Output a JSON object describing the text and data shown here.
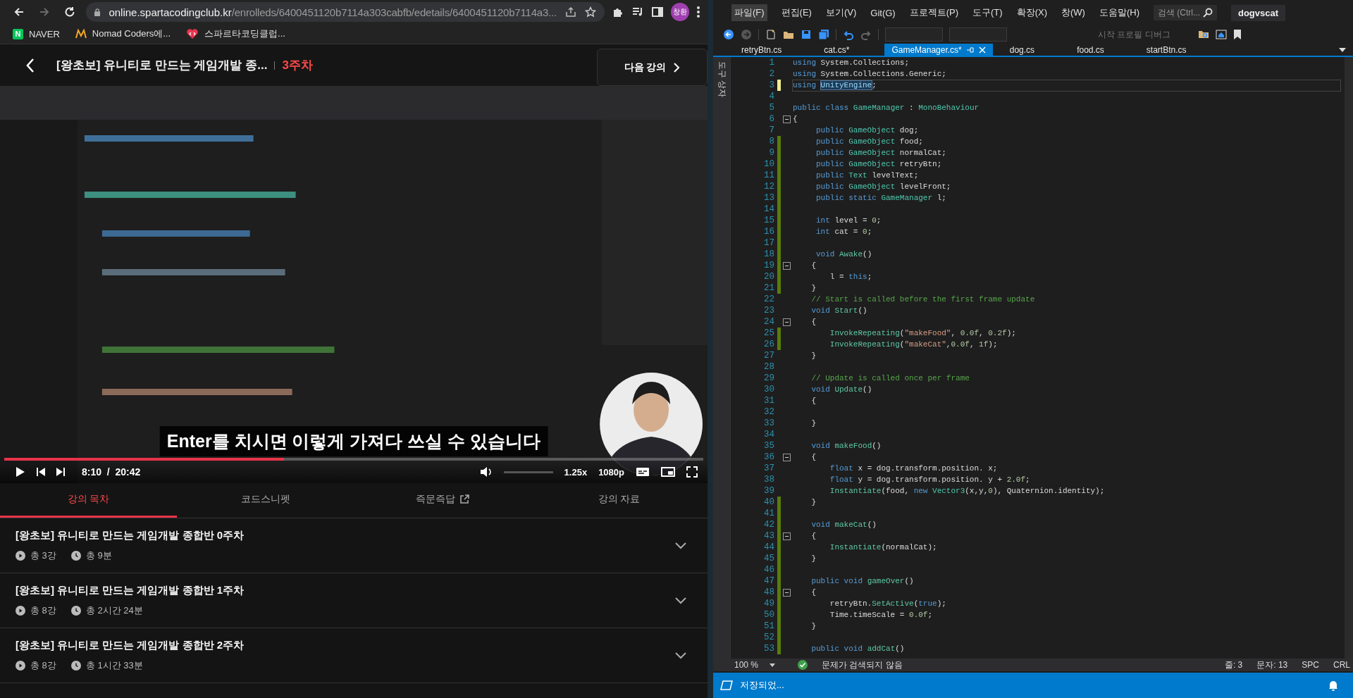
{
  "browser": {
    "nav": [
      {
        "kind": "back",
        "disabled": false
      },
      {
        "kind": "forward",
        "disabled": true
      },
      {
        "kind": "reload",
        "disabled": false
      }
    ],
    "address": {
      "host": "online.spartacodingclub.kr",
      "path": "/enrolleds/6400451120b7114a303cabfb/edetails/6400451120b7114a3..."
    },
    "profile": {
      "initials": "창환"
    },
    "bookmarks": [
      {
        "kind": "naver",
        "icon_text": "N",
        "label": "NAVER"
      },
      {
        "kind": "nomad",
        "label": "Nomad Coders에..."
      },
      {
        "kind": "sparta",
        "label": "스파르타코딩클럽..."
      }
    ]
  },
  "course_header": {
    "title": "[왕초보] 유니티로 만드는 게임개발 종...",
    "week": "3주차",
    "next_button": "다음 강의"
  },
  "video": {
    "kind": "picture",
    "subtitle": "Enter를 치시면 이렇게 가져다 쓰실 수 있습니다",
    "progress": {
      "level": 0.4
    },
    "time": "8:10  /  20:42",
    "volume": {
      "level": 0
    },
    "speed": "1.25x",
    "quality": "1080p"
  },
  "lecture_tabs": [
    {
      "label": "강의 목차",
      "selected": true,
      "external": false
    },
    {
      "label": "코드스니펫",
      "selected": false,
      "external": false
    },
    {
      "label": "즉문즉답",
      "selected": false,
      "external": true
    },
    {
      "label": "강의 자료",
      "selected": false,
      "external": false
    }
  ],
  "sections": [
    {
      "title": "[왕초보] 유니티로 만드는 게임개발 종합반 0주차",
      "lessons": "총 3강",
      "duration": "총 9분",
      "expanded": false
    },
    {
      "title": "[왕초보] 유니티로 만드는 게임개발 종합반 1주차",
      "lessons": "총 8강",
      "duration": "총 2시간 24분",
      "expanded": false
    },
    {
      "title": "[왕초보] 유니티로 만드는 게임개발 종합반 2주차",
      "lessons": "총 8강",
      "duration": "총 1시간 33분",
      "expanded": false
    }
  ],
  "ide": {
    "menu": [
      {
        "label": "파일(F)",
        "selected": true
      },
      {
        "label": "편집(E)",
        "selected": false
      },
      {
        "label": "보기(V)",
        "selected": false
      },
      {
        "label": "Git(G)",
        "selected": false
      },
      {
        "label": "프로젝트(P)",
        "selected": false
      },
      {
        "label": "도구(T)",
        "selected": false
      },
      {
        "label": "확장(X)",
        "selected": false
      },
      {
        "label": "창(W)",
        "selected": false
      },
      {
        "label": "도움말(H)",
        "selected": false
      }
    ],
    "search": {
      "placeholder": "검색 (Ctrl..."
    },
    "solution": "dogvscat",
    "debug_target": "시작 프로필 디버그",
    "side_tab": "도구 상자",
    "tabs": [
      {
        "label": "retryBtn.cs",
        "selected": false
      },
      {
        "label": "cat.cs*",
        "selected": false
      },
      {
        "label": "GameManager.cs*",
        "selected": true
      },
      {
        "label": "dog.cs",
        "selected": false
      },
      {
        "label": "food.cs",
        "selected": false
      },
      {
        "label": "startBtn.cs",
        "selected": false
      }
    ],
    "editor": {
      "lines": [
        {
          "n": "1",
          "fold": false,
          "current": false,
          "tokens": [
            {
              "kind": "kw",
              "text": "using"
            },
            {
              "kind": "txt",
              "text": " System.Collections;"
            }
          ]
        },
        {
          "n": "2",
          "fold": false,
          "current": false,
          "tokens": [
            {
              "kind": "kw",
              "text": "using"
            },
            {
              "kind": "txt",
              "text": " System.Collections.Generic;"
            }
          ]
        },
        {
          "n": "3",
          "color": "#efef91",
          "fold": false,
          "current": true,
          "tokens": [
            {
              "kind": "kw",
              "text": "using "
            },
            {
              "kind": "ref",
              "text": "UnityEngine"
            },
            {
              "kind": "txt",
              "text": ";"
            }
          ]
        },
        {
          "n": "4",
          "fold": false,
          "current": false
        },
        {
          "n": "5",
          "fold": false,
          "current": false,
          "tokens": [
            {
              "kind": "kw",
              "text": "public class "
            },
            {
              "kind": "type",
              "text": "GameManager"
            },
            {
              "kind": "txt",
              "text": " : "
            },
            {
              "kind": "type",
              "text": "MonoBehaviour"
            }
          ]
        },
        {
          "n": "6",
          "fold": true,
          "current": false,
          "tokens": [
            {
              "kind": "txt",
              "text": "{"
            }
          ]
        },
        {
          "n": "7",
          "fold": false,
          "current": false,
          "tokens": [
            {
              "kind": "kw",
              "text": "     public "
            },
            {
              "kind": "type",
              "text": "GameObject"
            },
            {
              "kind": "txt",
              "text": " dog;"
            }
          ]
        },
        {
          "n": "8",
          "color": "#587c0c",
          "fold": false,
          "current": false,
          "tokens": [
            {
              "kind": "kw",
              "text": "     public "
            },
            {
              "kind": "type",
              "text": "GameObject"
            },
            {
              "kind": "txt",
              "text": " food;"
            }
          ]
        },
        {
          "n": "9",
          "color": "#587c0c",
          "fold": false,
          "current": false,
          "tokens": [
            {
              "kind": "kw",
              "text": "     public "
            },
            {
              "kind": "type",
              "text": "GameObject"
            },
            {
              "kind": "txt",
              "text": " normalCat;"
            }
          ]
        },
        {
          "n": "10",
          "color": "#587c0c",
          "fold": false,
          "current": false,
          "tokens": [
            {
              "kind": "kw",
              "text": "     public "
            },
            {
              "kind": "type",
              "text": "GameObject"
            },
            {
              "kind": "txt",
              "text": " retryBtn;"
            }
          ]
        },
        {
          "n": "11",
          "color": "#587c0c",
          "fold": false,
          "current": false,
          "tokens": [
            {
              "kind": "kw",
              "text": "     public "
            },
            {
              "kind": "type",
              "text": "Text"
            },
            {
              "kind": "txt",
              "text": " levelText;"
            }
          ]
        },
        {
          "n": "12",
          "color": "#587c0c",
          "fold": false,
          "current": false,
          "tokens": [
            {
              "kind": "kw",
              "text": "     public "
            },
            {
              "kind": "type",
              "text": "GameObject"
            },
            {
              "kind": "txt",
              "text": " levelFront;"
            }
          ]
        },
        {
          "n": "13",
          "color": "#587c0c",
          "fold": false,
          "current": false,
          "tokens": [
            {
              "kind": "kw",
              "text": "     public static "
            },
            {
              "kind": "type",
              "text": "GameManager"
            },
            {
              "kind": "txt",
              "text": " l;"
            }
          ]
        },
        {
          "n": "14",
          "color": "#587c0c",
          "fold": false,
          "current": false
        },
        {
          "n": "15",
          "color": "#587c0c",
          "fold": false,
          "current": false,
          "tokens": [
            {
              "kind": "kw",
              "text": "     int"
            },
            {
              "kind": "txt",
              "text": " level = "
            },
            {
              "kind": "num",
              "text": "0"
            },
            {
              "kind": "txt",
              "text": ";"
            }
          ]
        },
        {
          "n": "16",
          "color": "#587c0c",
          "fold": false,
          "current": false,
          "tokens": [
            {
              "kind": "kw",
              "text": "     int"
            },
            {
              "kind": "txt",
              "text": " cat = "
            },
            {
              "kind": "num",
              "text": "0"
            },
            {
              "kind": "txt",
              "text": ";"
            }
          ]
        },
        {
          "n": "17",
          "color": "#587c0c",
          "fold": false,
          "current": false
        },
        {
          "n": "18",
          "color": "#587c0c",
          "fold": false,
          "current": false,
          "tokens": [
            {
              "kind": "kw",
              "text": "     void "
            },
            {
              "kind": "fn",
              "text": "Awake"
            },
            {
              "kind": "txt",
              "text": "()"
            }
          ]
        },
        {
          "n": "19",
          "color": "#587c0c",
          "fold": true,
          "current": false,
          "tokens": [
            {
              "kind": "txt",
              "text": "    {"
            }
          ]
        },
        {
          "n": "20",
          "color": "#587c0c",
          "fold": false,
          "current": false,
          "tokens": [
            {
              "kind": "txt",
              "text": "        l = "
            },
            {
              "kind": "kw",
              "text": "this"
            },
            {
              "kind": "txt",
              "text": ";"
            }
          ]
        },
        {
          "n": "21",
          "color": "#587c0c",
          "fold": false,
          "current": false,
          "tokens": [
            {
              "kind": "txt",
              "text": "    }"
            }
          ]
        },
        {
          "n": "22",
          "fold": false,
          "current": false,
          "tokens": [
            {
              "kind": "cmt",
              "text": "    // Start is called before the first frame update"
            }
          ]
        },
        {
          "n": "23",
          "fold": false,
          "current": false,
          "tokens": [
            {
              "kind": "kw",
              "text": "    void "
            },
            {
              "kind": "fn",
              "text": "Start"
            },
            {
              "kind": "txt",
              "text": "()"
            }
          ]
        },
        {
          "n": "24",
          "fold": true,
          "current": false,
          "tokens": [
            {
              "kind": "txt",
              "text": "    {"
            }
          ]
        },
        {
          "n": "25",
          "color": "#587c0c",
          "fold": false,
          "current": false,
          "tokens": [
            {
              "kind": "fn",
              "text": "        InvokeRepeating"
            },
            {
              "kind": "txt",
              "text": "("
            },
            {
              "kind": "str",
              "text": "\"makeFood\""
            },
            {
              "kind": "txt",
              "text": ", "
            },
            {
              "kind": "num",
              "text": "0.0f"
            },
            {
              "kind": "txt",
              "text": ", "
            },
            {
              "kind": "num",
              "text": "0.2f"
            },
            {
              "kind": "txt",
              "text": ");"
            }
          ]
        },
        {
          "n": "26",
          "color": "#587c0c",
          "fold": false,
          "current": false,
          "tokens": [
            {
              "kind": "fn",
              "text": "        InvokeRepeating"
            },
            {
              "kind": "txt",
              "text": "("
            },
            {
              "kind": "str",
              "text": "\"makeCat\""
            },
            {
              "kind": "txt",
              "text": ","
            },
            {
              "kind": "num",
              "text": "0.0f"
            },
            {
              "kind": "txt",
              "text": ", "
            },
            {
              "kind": "num",
              "text": "1f"
            },
            {
              "kind": "txt",
              "text": ");"
            }
          ]
        },
        {
          "n": "27",
          "fold": false,
          "current": false,
          "tokens": [
            {
              "kind": "txt",
              "text": "    }"
            }
          ]
        },
        {
          "n": "28",
          "fold": false,
          "current": false
        },
        {
          "n": "29",
          "fold": false,
          "current": false,
          "tokens": [
            {
              "kind": "cmt",
              "text": "    // Update is called once per frame"
            }
          ]
        },
        {
          "n": "30",
          "fold": false,
          "current": false,
          "tokens": [
            {
              "kind": "kw",
              "text": "    void "
            },
            {
              "kind": "fn",
              "text": "Update"
            },
            {
              "kind": "txt",
              "text": "()"
            }
          ]
        },
        {
          "n": "31",
          "fold": false,
          "current": false,
          "tokens": [
            {
              "kind": "txt",
              "text": "    {"
            }
          ]
        },
        {
          "n": "32",
          "fold": false,
          "current": false
        },
        {
          "n": "33",
          "fold": false,
          "current": false,
          "tokens": [
            {
              "kind": "txt",
              "text": "    }"
            }
          ]
        },
        {
          "n": "34",
          "fold": false,
          "current": false
        },
        {
          "n": "35",
          "fold": false,
          "current": false,
          "tokens": [
            {
              "kind": "kw",
              "text": "    void "
            },
            {
              "kind": "fn",
              "text": "makeFood"
            },
            {
              "kind": "txt",
              "text": "()"
            }
          ]
        },
        {
          "n": "36",
          "fold": true,
          "current": false,
          "tokens": [
            {
              "kind": "txt",
              "text": "    {"
            }
          ]
        },
        {
          "n": "37",
          "fold": false,
          "current": false,
          "tokens": [
            {
              "kind": "kw",
              "text": "        float"
            },
            {
              "kind": "txt",
              "text": " x = dog.transform.position. x;"
            }
          ]
        },
        {
          "n": "38",
          "fold": false,
          "current": false,
          "tokens": [
            {
              "kind": "kw",
              "text": "        float"
            },
            {
              "kind": "txt",
              "text": " y = dog.transform.position. y + "
            },
            {
              "kind": "num",
              "text": "2.0f"
            },
            {
              "kind": "txt",
              "text": ";"
            }
          ]
        },
        {
          "n": "39",
          "fold": false,
          "current": false,
          "tokens": [
            {
              "kind": "fn",
              "text": "        Instantiate"
            },
            {
              "kind": "txt",
              "text": "(food, "
            },
            {
              "kind": "kw",
              "text": "new "
            },
            {
              "kind": "type",
              "text": "Vector3"
            },
            {
              "kind": "txt",
              "text": "(x,y,"
            },
            {
              "kind": "num",
              "text": "0"
            },
            {
              "kind": "txt",
              "text": "), Quaternion.identity);"
            }
          ]
        },
        {
          "n": "40",
          "color": "#587c0c",
          "fold": false,
          "current": false,
          "tokens": [
            {
              "kind": "txt",
              "text": "    }"
            }
          ]
        },
        {
          "n": "41",
          "color": "#587c0c",
          "fold": false,
          "current": false
        },
        {
          "n": "42",
          "color": "#587c0c",
          "fold": false,
          "current": false,
          "tokens": [
            {
              "kind": "kw",
              "text": "    void "
            },
            {
              "kind": "fn",
              "text": "makeCat"
            },
            {
              "kind": "txt",
              "text": "()"
            }
          ]
        },
        {
          "n": "43",
          "color": "#587c0c",
          "fold": true,
          "current": false,
          "tokens": [
            {
              "kind": "txt",
              "text": "    {"
            }
          ]
        },
        {
          "n": "44",
          "color": "#587c0c",
          "fold": false,
          "current": false,
          "tokens": [
            {
              "kind": "fn",
              "text": "        Instantiate"
            },
            {
              "kind": "txt",
              "text": "(normalCat);"
            }
          ]
        },
        {
          "n": "45",
          "color": "#587c0c",
          "fold": false,
          "current": false,
          "tokens": [
            {
              "kind": "txt",
              "text": "    }"
            }
          ]
        },
        {
          "n": "46",
          "color": "#587c0c",
          "fold": false,
          "current": false
        },
        {
          "n": "47",
          "color": "#587c0c",
          "fold": false,
          "current": false,
          "tokens": [
            {
              "kind": "kw",
              "text": "    public void "
            },
            {
              "kind": "fn",
              "text": "gameOver"
            },
            {
              "kind": "txt",
              "text": "()"
            }
          ]
        },
        {
          "n": "48",
          "color": "#587c0c",
          "fold": true,
          "current": false,
          "tokens": [
            {
              "kind": "txt",
              "text": "    {"
            }
          ]
        },
        {
          "n": "49",
          "color": "#587c0c",
          "fold": false,
          "current": false,
          "tokens": [
            {
              "kind": "txt",
              "text": "        retryBtn."
            },
            {
              "kind": "fn",
              "text": "SetActive"
            },
            {
              "kind": "txt",
              "text": "("
            },
            {
              "kind": "kw",
              "text": "true"
            },
            {
              "kind": "txt",
              "text": ");"
            }
          ]
        },
        {
          "n": "50",
          "color": "#587c0c",
          "fold": false,
          "current": false,
          "tokens": [
            {
              "kind": "txt",
              "text": "        Time.timeScale = "
            },
            {
              "kind": "num",
              "text": "0.0f"
            },
            {
              "kind": "txt",
              "text": ";"
            }
          ]
        },
        {
          "n": "51",
          "color": "#587c0c",
          "fold": false,
          "current": false,
          "tokens": [
            {
              "kind": "txt",
              "text": "    }"
            }
          ]
        },
        {
          "n": "52",
          "color": "#587c0c",
          "fold": false,
          "current": false
        },
        {
          "n": "53",
          "color": "#587c0c",
          "fold": false,
          "current": false,
          "tokens": [
            {
              "kind": "kw",
              "text": "    public void "
            },
            {
              "kind": "fn",
              "text": "addCat"
            },
            {
              "kind": "txt",
              "text": "()"
            }
          ]
        }
      ]
    },
    "status": {
      "zoom": "100 %",
      "issues": "문제가 검색되지 않음",
      "line": "줄: 3",
      "column": "문자: 13",
      "whitespace": "SPC",
      "line_ending": "CRL"
    },
    "status_bar": {
      "message": "저장되었..."
    }
  }
}
